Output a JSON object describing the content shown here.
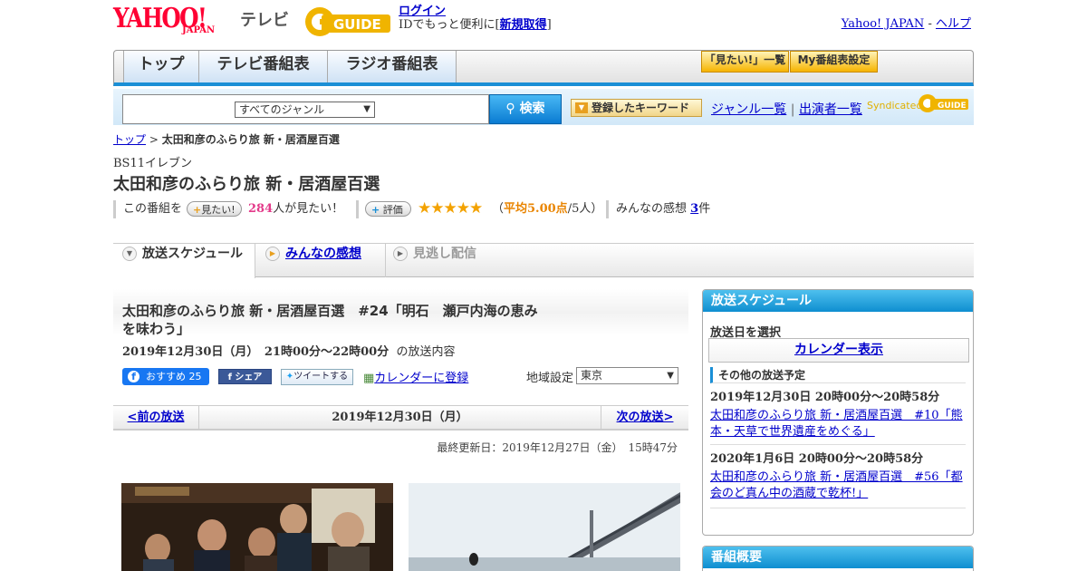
{
  "header": {
    "yahoo": "YAHOO!",
    "japan": "JAPAN",
    "tv": "テレビ",
    "gguide": "GUIDE",
    "login_link": "ログイン",
    "login_text_prefix": "IDでもっと便利に[",
    "register_link": "新規取得",
    "login_text_suffix": "]",
    "yahoo_japan_link": "Yahoo! JAPAN",
    "dash": " - ",
    "help_link": "ヘルプ"
  },
  "nav": {
    "tabs": [
      "トップ",
      "テレビ番組表",
      "ラジオ番組表"
    ],
    "want_list": "「見たい!」一覧",
    "my_schedule": "My番組表設定"
  },
  "search": {
    "placeholder": "",
    "genre_select": "すべてのジャンル",
    "button": "検索",
    "keyword_button": "登録したキーワード",
    "genre_list": "ジャンル一覧",
    "divider": "|",
    "performer_list": "出演者一覧",
    "syndicated": "Syndicated",
    "syndicated_logo": "GUIDE"
  },
  "breadcrumb": {
    "top": "トップ",
    "sep": " > ",
    "current": "太田和彦のふらり旅 新・居酒屋百選"
  },
  "program": {
    "channel": "BS11イレブン",
    "title": "太田和彦のふらり旅 新・居酒屋百選",
    "this_program": "この番組を",
    "want_button": "見たい!",
    "want_count": "284",
    "want_suffix": "人が見たい！",
    "rating_button": "評価",
    "stars": "★★★★★",
    "avg_open": "（",
    "avg": "平均5.00点",
    "avg_people": "/5人）",
    "reviews_label": "みんなの感想",
    "reviews_count": "3",
    "reviews_unit": "件"
  },
  "subtabs": {
    "schedule": "放送スケジュール",
    "reviews": "みんなの感想",
    "streaming": "見逃し配信"
  },
  "episode": {
    "title": "太田和彦のふらり旅 新・居酒屋百選　#24「明石　瀬戸内海の恵みを味わう」",
    "datetime": "2019年12月30日（月）　21時00分～22時00分",
    "content_label": "の放送内容",
    "fb_recommend": "おすすめ",
    "fb_count": "25",
    "fb_share": "シェア",
    "tweet": "ツイートする",
    "calendar_register": "カレンダーに登録",
    "region_label": "地域設定",
    "region_value": "東京"
  },
  "pager": {
    "prev": "<前の放送",
    "current": "2019年12月30日（月）",
    "next": "次の放送>"
  },
  "updated": "最終更新日：2019年12月27日（金）　15時47分",
  "sidebar": {
    "schedule_header": "放送スケジュール",
    "select_date": "放送日を選択",
    "calendar_display": "カレンダー表示",
    "other_header": "その他の放送予定",
    "other_items": [
      {
        "date": "2019年12月30日  20時00分～20時58分",
        "title": "太田和彦のふらり旅 新・居酒屋百選　#10「熊本・天草で世界遺産をめぐる」"
      },
      {
        "date": "2020年1月6日  20時00分～20時58分",
        "title": "太田和彦のふらり旅 新・居酒屋百選　#56「都会のど真ん中の酒蔵で乾杯!」"
      }
    ],
    "overview_header": "番組概要"
  },
  "colors": {
    "accent_blue": "#1a8fd6",
    "yahoo_red": "#ff0033",
    "star_orange": "#f3a200",
    "pink": "#e33a8a",
    "facebook": "#1877f2"
  }
}
